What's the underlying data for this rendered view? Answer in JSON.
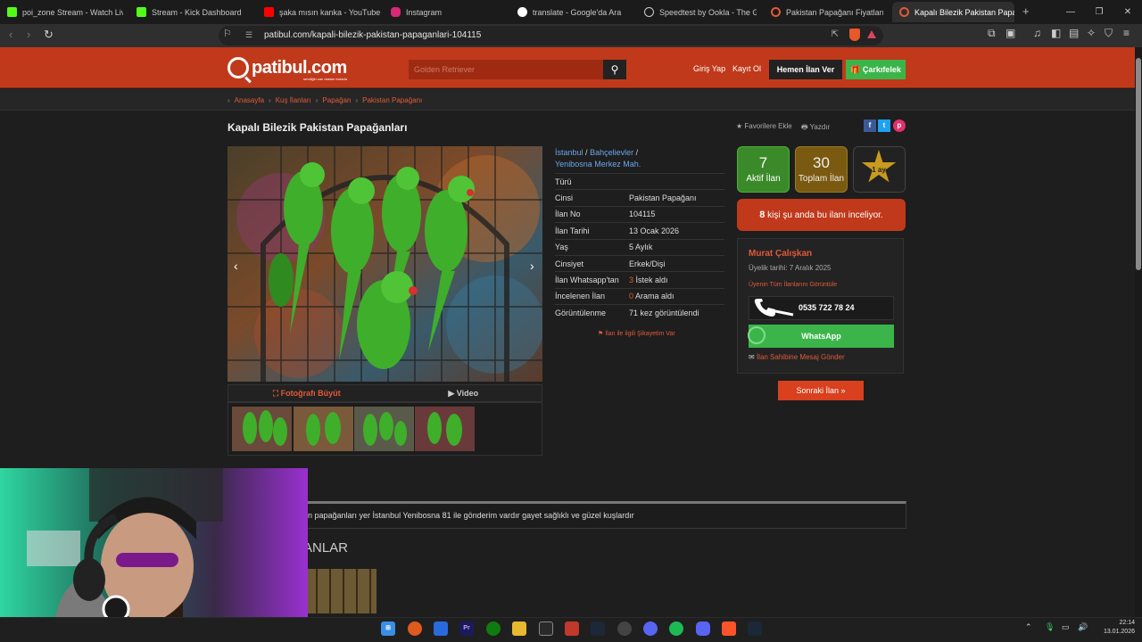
{
  "browser": {
    "tabs": [
      {
        "title": "poi_zone Stream - Watch Live c",
        "color": "#53fc18"
      },
      {
        "title": "Stream - Kick Dashboard",
        "color": "#53fc18"
      },
      {
        "title": "şaka mısın kanka - YouTube",
        "color": "#ff0000"
      },
      {
        "title": "Instagram",
        "color": "#d62976"
      },
      {
        "title": "translate - Google'da Ara",
        "color": "#ffffff"
      },
      {
        "title": "Speedtest by Ookla - The Glob",
        "color": "#cccccc"
      },
      {
        "title": "Pakistan Papağanı Fiyatları Ve",
        "color": "#e05a3a"
      },
      {
        "title": "Kapalı Bilezik Pakistan Papa",
        "color": "#e05a3a"
      }
    ],
    "active_tab_close": "✕",
    "new_tab": "+",
    "url": "patibul.com/kapali-bilezik-pakistan-papaganlari-104115",
    "window_controls": [
      "—",
      "❐",
      "✕"
    ]
  },
  "site": {
    "logo": "patibul.com",
    "tagline": "sevdiğin can dostun burada",
    "search_placeholder": "Golden Retriever",
    "login": "Giriş Yap",
    "register": "Kayıt Ol",
    "post_ad": "Hemen İlan Ver",
    "wheel": "🎁 Çarkıfelek"
  },
  "breadcrumb": [
    "Anasayfa",
    "Kuş İlanları",
    "Papağan",
    "Pakistan Papağanı"
  ],
  "listing": {
    "title": "Kapalı Bilezik Pakistan Papağanları",
    "fav": "★ Favorilere Ekle",
    "print": "🖶 Yazdır",
    "photo_enlarge": "⛶ Fotoğrafı Büyüt",
    "video": "▶ Video",
    "location": {
      "city": "İstanbul",
      "district": "Bahçelievler",
      "neighborhood": "Yenibosna Merkez Mah."
    },
    "details": [
      {
        "key": "Türü",
        "value": ""
      },
      {
        "key": "Cinsi",
        "value": "Pakistan Papağanı"
      },
      {
        "key": "İlan No",
        "value": "104115"
      },
      {
        "key": "İlan Tarihi",
        "value": "13 Ocak 2026"
      },
      {
        "key": "Yaş",
        "value": "5 Aylık"
      },
      {
        "key": "Cinsiyet",
        "value": "Erkek/Dişi"
      },
      {
        "key": "İlan Whatsapp'tan",
        "value_num": "3",
        "value": " İstek aldı"
      },
      {
        "key": "İncelenen İlan",
        "value_num": "0",
        "value": " Arama aldı"
      },
      {
        "key": "Görüntülenme",
        "value": "71 kez görüntülendi"
      }
    ],
    "complaint": "⚑ İlan ile ilgili Şikayetim Var"
  },
  "stats": {
    "active_count": "7",
    "active_label": "Aktif İlan",
    "total_count": "30",
    "total_label": "Toplam İlan",
    "badge": "1 ay",
    "viewers_count": "8",
    "viewers_text": " kişi şu anda bu ilanı inceliyor."
  },
  "seller": {
    "name": "Murat Çalışkan",
    "since": "Üyelik tarihi: 7 Aralık 2025",
    "all_ads": "Üyenin Tüm İlanlarını Görüntüle",
    "phone": "0535 722 78 24",
    "whatsapp": "WhatsApp",
    "message": "İlan Sahibine Mesaj Gönder"
  },
  "next_ad": "Sonraki İlan »",
  "description": "an papağanları yer İstanbul Yenibosna 81 ile gönderim vardır gayet sağlıklı ve güzel kuşlardır",
  "similar_title": "ANLAR",
  "taskbar": {
    "time": "22:14",
    "date": "13.01.2026"
  },
  "colors": {
    "brand": "#c0391b",
    "green": "#3bb54a",
    "gold": "#c89a1e",
    "link": "#e05a3a"
  }
}
